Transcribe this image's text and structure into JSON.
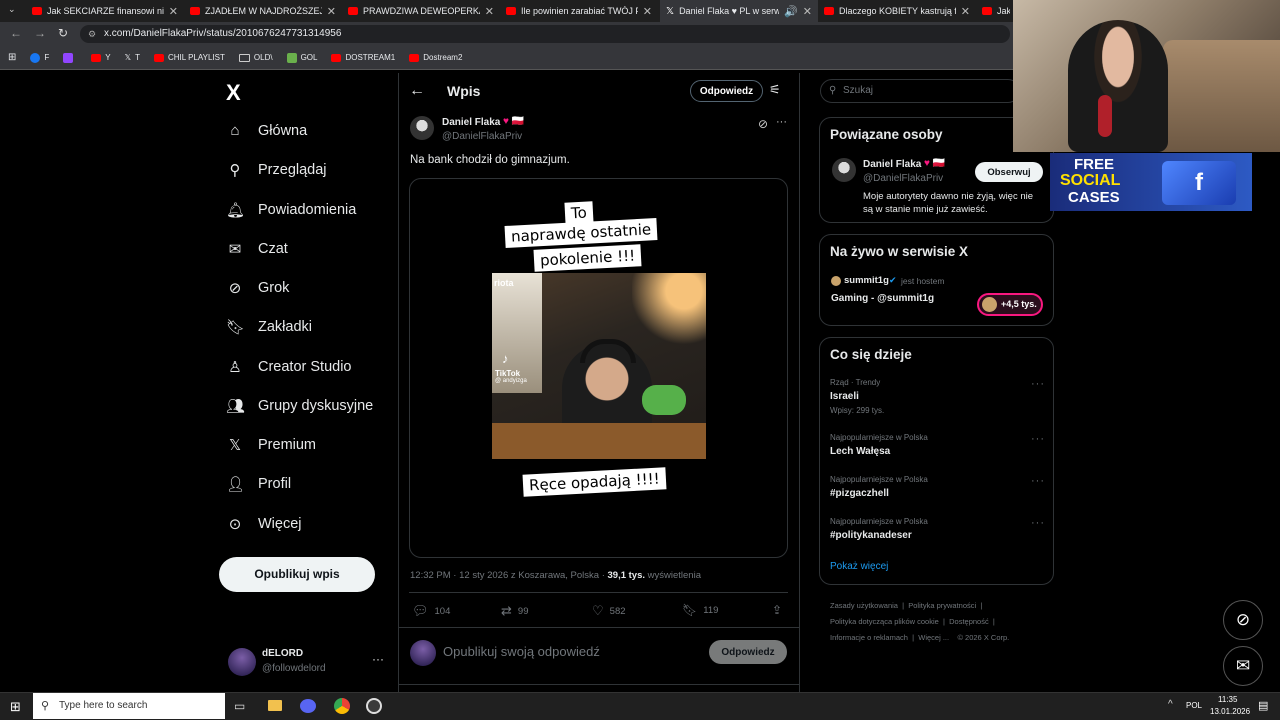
{
  "browser": {
    "tabs": [
      {
        "title": "Jak SEKCIARZE finansowi niszcz",
        "icon": "youtube-icon",
        "active": false
      },
      {
        "title": "ZJADŁEM W NAJDROŻSZEJ I NA",
        "icon": "youtube-icon",
        "active": false
      },
      {
        "title": "PRAWDZIWA DEWEOPERKA - I",
        "icon": "youtube-icon",
        "active": false
      },
      {
        "title": "Ile powinien zarabiać TWÓJ FAC",
        "icon": "youtube-icon",
        "active": false
      },
      {
        "title": "Daniel Flaka ♥ PL w serwis",
        "icon": "x-icon",
        "active": true
      },
      {
        "title": "Dlaczego KOBIETY kastrują facet",
        "icon": "youtube-icon",
        "active": false
      },
      {
        "title": "Jak",
        "icon": "youtube-icon",
        "active": false
      }
    ],
    "url": "x.com/DanielFlakaPriv/status/2010676247731314956",
    "bookmarks": [
      "F",
      "",
      "Y",
      "T",
      "CHIL PLAYLIST",
      "OLD\\",
      "GOL",
      "DOSTREAM1",
      "Dostream2"
    ]
  },
  "sidebar": {
    "logo": "X",
    "items": [
      {
        "label": "Główna",
        "icon": "home-icon"
      },
      {
        "label": "Przeglądaj",
        "icon": "search-icon"
      },
      {
        "label": "Powiadomienia",
        "icon": "bell-icon"
      },
      {
        "label": "Czat",
        "icon": "mail-icon"
      },
      {
        "label": "Grok",
        "icon": "grok-icon"
      },
      {
        "label": "Zakładki",
        "icon": "bookmark-icon"
      },
      {
        "label": "Creator Studio",
        "icon": "creator-icon"
      },
      {
        "label": "Grupy dyskusyjne",
        "icon": "groups-icon"
      },
      {
        "label": "Premium",
        "icon": "x-icon"
      },
      {
        "label": "Profil",
        "icon": "person-icon"
      },
      {
        "label": "Więcej",
        "icon": "more-circle-icon"
      }
    ],
    "publish_label": "Opublikuj wpis",
    "account": {
      "name": "dELORD",
      "handle": "@followdelord",
      "more": "···"
    }
  },
  "post": {
    "header_title": "Wpis",
    "header_reply": "Odpowiedz",
    "author_name": "Daniel Flaka",
    "author_badges": "♥ 🇵🇱",
    "author_handle": "@DanielFlakaPriv",
    "text": "Na bank chodził do gimnazjum.",
    "media": {
      "caption_top_1": "To",
      "caption_top_2": "naprawdę ostatnie",
      "caption_top_3": "pokolenie !!!",
      "caption_bottom": "Ręce opadają !!!!",
      "clip_overlay_word": "riota",
      "tiktok_label": "TikTok",
      "tiktok_handle": "@ andyizga"
    },
    "time": "12:32 PM",
    "date_location": "12 sty 2026 z Koszarawa, Polska",
    "views_count": "39,1 tys.",
    "views_label": "wyświetlenia",
    "stats": {
      "replies": "104",
      "reposts": "99",
      "likes": "582",
      "bookmarks": "119"
    },
    "reply_placeholder": "Opublikuj swoją odpowiedź",
    "reply_button": "Odpowiedz"
  },
  "right": {
    "search_placeholder": "Szukaj",
    "related": {
      "title": "Powiązane osoby",
      "name": "Daniel Flaka",
      "badges": "♥ 🇵🇱",
      "handle": "@DanielFlakaPriv",
      "bio": "Moje autorytety dawno nie żyją, więc nie są w stanie mnie już zawieść.",
      "follow": "Obserwuj"
    },
    "live": {
      "title": "Na żywo w serwisie X",
      "host": "summit1g",
      "host_suffix": "jest hostem",
      "stream_title": "Gaming - @summit1g",
      "listeners": "+4,5 tys."
    },
    "trends": {
      "title": "Co się dzieje",
      "items": [
        {
          "meta": "Rząd · Trendy",
          "name": "Israeli",
          "posts": "Wpisy: 299 tys."
        },
        {
          "meta": "Najpopularniejsze w Polska",
          "name": "Lech Wałęsa",
          "posts": ""
        },
        {
          "meta": "Najpopularniejsze w Polska",
          "name": "#pizgaczhell",
          "posts": ""
        },
        {
          "meta": "Najpopularniejsze w Polska",
          "name": "#politykanadeser",
          "posts": ""
        }
      ],
      "show_more": "Pokaż więcej"
    },
    "footer": {
      "line1a": "Zasady użytkowania",
      "line1b": "Polityka prywatności",
      "line2a": "Polityka dotycząca plików cookie",
      "line2b": "Dostępność",
      "line3a": "Informacje o reklamach",
      "line3b": "Więcej ...",
      "line3c": "© 2026 X Corp."
    }
  },
  "overlay": {
    "promo_line1": "FREE",
    "promo_line2": "SOCIAL",
    "promo_line3": "CASES"
  },
  "taskbar": {
    "search_placeholder": "Type here to search",
    "lang": "POL",
    "time": "11:35",
    "date": "13.01.2026"
  },
  "colors": {
    "accent": "#1d9bf0",
    "heart": "#f91880",
    "bg": "#000000",
    "border": "#2f3336"
  }
}
